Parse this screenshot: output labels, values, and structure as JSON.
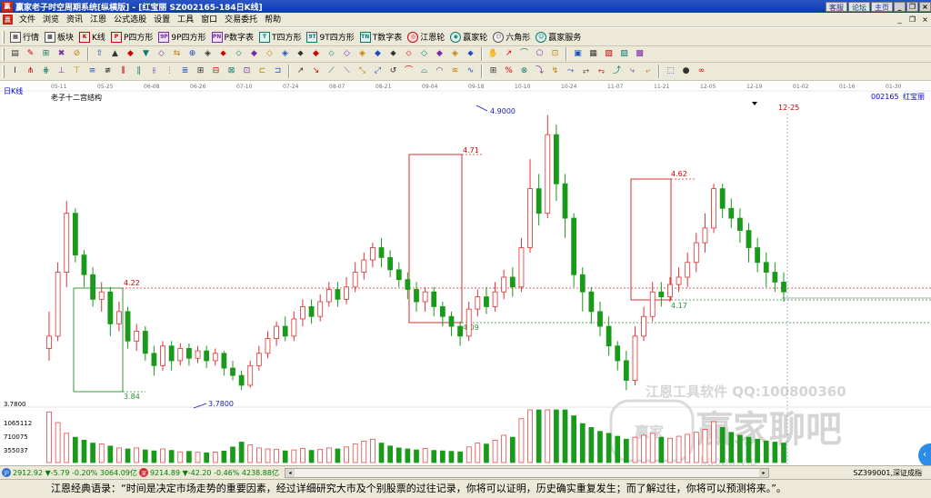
{
  "window": {
    "title": "赢家老子时空周期系统[纵横版] - [红宝丽  SZ002165-184日K线]",
    "buttons": [
      "客服",
      "论坛",
      "主页"
    ],
    "controls": [
      "_",
      "❐",
      "×"
    ]
  },
  "menu": {
    "items": [
      "文件",
      "浏览",
      "资讯",
      "江恩",
      "公式选股",
      "设置",
      "工具",
      "窗口",
      "交易委托",
      "帮助"
    ],
    "controls": [
      "_",
      "❐",
      "×"
    ]
  },
  "toolbar1": {
    "items": [
      {
        "label": "行情",
        "icon": "grid-icon",
        "glyph": "▦",
        "style": "ic-blk"
      },
      {
        "label": "板块",
        "icon": "block-icon",
        "glyph": "▩",
        "style": "ic-blk"
      },
      {
        "label": "K线",
        "icon": "kline-icon",
        "glyph": "K",
        "style": "ic-red"
      },
      {
        "label": "P四方形",
        "icon": "p-square-icon",
        "glyph": "P",
        "style": "ic-red"
      },
      {
        "label": "9P四方形",
        "icon": "9p-square-icon",
        "glyph": "9P",
        "style": "ic-pur"
      },
      {
        "label": "P数字表",
        "icon": "p-table-icon",
        "glyph": "PN",
        "style": "ic-pur"
      },
      {
        "label": "T四方形",
        "icon": "t-square-icon",
        "glyph": "T",
        "style": "ic-teal"
      },
      {
        "label": "9T四方形",
        "icon": "9t-square-icon",
        "glyph": "9T",
        "style": "ic-teal"
      },
      {
        "label": "T数字表",
        "icon": "t-table-icon",
        "glyph": "TN",
        "style": "ic-teal"
      },
      {
        "label": "江恩轮",
        "icon": "gann-wheel-icon",
        "glyph": "◎",
        "style": "ic-red ic-circ"
      },
      {
        "label": "赢家轮",
        "icon": "winner-wheel-icon",
        "glyph": "◉",
        "style": "ic-teal ic-circ"
      },
      {
        "label": "六角形",
        "icon": "hexagon-icon",
        "glyph": "⬡",
        "style": "ic-blk ic-circ"
      },
      {
        "label": "赢家服务",
        "icon": "service-icon",
        "glyph": "☺",
        "style": "ic-teal ic-circ"
      }
    ]
  },
  "toolbar2": {
    "icons": [
      "▤",
      "✎",
      "⊞",
      "✖",
      "⊘",
      "⇧",
      "▲",
      "◆",
      "▼",
      "◇",
      "⇆",
      "⊕",
      "◈",
      "⬥",
      "⬦",
      "◆",
      "◇",
      "◈",
      "⬥",
      "◆",
      "⬦",
      "◇",
      "◈",
      "◆",
      "⬥",
      "⬦",
      "◇",
      "◆",
      "◈",
      "⬥",
      "✋",
      "↗",
      "⌒",
      "⬠",
      "⊡",
      "▣",
      "▦",
      "▧",
      "▨",
      "▩"
    ]
  },
  "toolbar3": {
    "icons": [
      "I",
      "⋔",
      "⋕",
      "⊥",
      "⊤",
      "≡",
      "≢",
      "⫼",
      "∥",
      "⫲",
      "⋮",
      "≣",
      "⊞",
      "⊟",
      "⊠",
      "⊡",
      "⊏",
      "⊐",
      "↗",
      "↘",
      "⟋",
      "⟍",
      "⤡",
      "⤢",
      "↺",
      "⌒",
      "⌓",
      "◠",
      "≋",
      "∿",
      "⊞",
      "%",
      "⊗",
      "⤵",
      "↯",
      "⤳",
      "⥅",
      "⥆",
      "⤴",
      "⤷",
      "⤶",
      "⬚",
      "●",
      "∞"
    ]
  },
  "chart": {
    "period_label": "日K线",
    "study_label": "老子十二宫结构",
    "stock_code": "002165",
    "stock_name": "红宝丽",
    "dates": [
      "05-11",
      "05-25",
      "06-08",
      "06-26",
      "07-10",
      "07-24",
      "08-07",
      "08-21",
      "09-04",
      "09-18",
      "10-10",
      "10-24",
      "11-07",
      "11-21",
      "12-05",
      "12-19",
      "01-02",
      "01-16",
      "01-30"
    ],
    "marker_date": "12-25",
    "annotations": [
      "4.9000",
      "4.71",
      "4.62",
      "4.22",
      "4.17",
      "4.09",
      "3.84",
      "3.7800"
    ],
    "volume_axis": [
      "3.7800",
      "1065112",
      "710075",
      "355037"
    ],
    "watermark": {
      "line1": "江恩工具软件  QQ:100800360",
      "line2": "赢家聊吧",
      "logo": "赢家",
      "url": "liaoba.vip"
    },
    "candles": [
      [
        3.95,
        4.0,
        4.1,
        3.9
      ],
      [
        4.0,
        4.26,
        4.3,
        3.98
      ],
      [
        4.26,
        4.5,
        4.55,
        4.2
      ],
      [
        4.5,
        4.33,
        4.52,
        4.3
      ],
      [
        4.33,
        4.25,
        4.35,
        4.2
      ],
      [
        4.25,
        4.15,
        4.28,
        4.12
      ],
      [
        4.15,
        4.18,
        4.22,
        4.1
      ],
      [
        4.18,
        4.05,
        4.2,
        4.0
      ],
      [
        4.05,
        4.1,
        4.14,
        4.02
      ],
      [
        4.1,
        3.98,
        4.12,
        3.95
      ],
      [
        3.98,
        4.02,
        4.05,
        3.94
      ],
      [
        4.02,
        3.93,
        4.04,
        3.9
      ],
      [
        3.93,
        3.88,
        3.96,
        3.84
      ],
      [
        3.88,
        3.96,
        3.98,
        3.86
      ],
      [
        3.96,
        3.9,
        3.98,
        3.86
      ],
      [
        3.9,
        3.95,
        3.97,
        3.88
      ],
      [
        3.95,
        3.91,
        3.97,
        3.88
      ],
      [
        3.91,
        3.94,
        3.96,
        3.89
      ],
      [
        3.94,
        3.9,
        3.96,
        3.87
      ],
      [
        3.9,
        3.93,
        3.95,
        3.88
      ],
      [
        3.93,
        3.87,
        3.94,
        3.84
      ],
      [
        3.87,
        3.84,
        3.9,
        3.82
      ],
      [
        3.84,
        3.8,
        3.86,
        3.78
      ],
      [
        3.8,
        3.88,
        3.9,
        3.79
      ],
      [
        3.88,
        3.93,
        3.96,
        3.86
      ],
      [
        3.93,
        3.99,
        4.02,
        3.91
      ],
      [
        3.99,
        4.04,
        4.06,
        3.96
      ],
      [
        4.04,
        4.0,
        4.08,
        3.98
      ],
      [
        4.0,
        4.07,
        4.1,
        3.98
      ],
      [
        4.07,
        4.12,
        4.15,
        4.04
      ],
      [
        4.12,
        4.08,
        4.15,
        4.05
      ],
      [
        4.08,
        4.14,
        4.17,
        4.06
      ],
      [
        4.14,
        4.19,
        4.22,
        4.12
      ],
      [
        4.19,
        4.15,
        4.22,
        4.12
      ],
      [
        4.15,
        4.2,
        4.24,
        4.13
      ],
      [
        4.2,
        4.26,
        4.3,
        4.18
      ],
      [
        4.26,
        4.31,
        4.34,
        4.23
      ],
      [
        4.31,
        4.36,
        4.38,
        4.28
      ],
      [
        4.36,
        4.32,
        4.4,
        4.28
      ],
      [
        4.32,
        4.27,
        4.35,
        4.24
      ],
      [
        4.27,
        4.23,
        4.3,
        4.2
      ],
      [
        4.23,
        4.19,
        4.26,
        4.15
      ],
      [
        4.19,
        4.14,
        4.22,
        4.1
      ],
      [
        4.14,
        4.18,
        4.2,
        4.1
      ],
      [
        4.18,
        4.12,
        4.2,
        4.08
      ],
      [
        4.12,
        4.08,
        4.14,
        4.04
      ],
      [
        4.08,
        4.04,
        4.1,
        4.0
      ],
      [
        4.04,
        4.0,
        4.06,
        3.96
      ],
      [
        4.0,
        4.11,
        4.14,
        3.98
      ],
      [
        4.11,
        4.16,
        4.19,
        4.08
      ],
      [
        4.16,
        4.12,
        4.2,
        4.09
      ],
      [
        4.12,
        4.18,
        4.22,
        4.1
      ],
      [
        4.18,
        4.24,
        4.27,
        4.15
      ],
      [
        4.24,
        4.2,
        4.28,
        4.16
      ],
      [
        4.2,
        4.36,
        4.4,
        4.18
      ],
      [
        4.36,
        4.6,
        4.72,
        4.34
      ],
      [
        4.6,
        4.5,
        4.66,
        4.45
      ],
      [
        4.5,
        4.82,
        4.9,
        4.48
      ],
      [
        4.82,
        4.62,
        4.86,
        4.55
      ],
      [
        4.62,
        4.48,
        4.66,
        4.4
      ],
      [
        4.48,
        4.25,
        4.5,
        4.2
      ],
      [
        4.25,
        4.18,
        4.28,
        4.1
      ],
      [
        4.18,
        4.1,
        4.2,
        4.05
      ],
      [
        4.1,
        4.04,
        4.14,
        4.0
      ],
      [
        4.04,
        3.96,
        4.08,
        3.92
      ],
      [
        3.96,
        3.9,
        3.98,
        3.86
      ],
      [
        3.9,
        3.82,
        3.94,
        3.78
      ],
      [
        3.82,
        4.0,
        4.04,
        3.8
      ],
      [
        4.0,
        4.08,
        4.12,
        3.98
      ],
      [
        4.08,
        4.18,
        4.22,
        4.06
      ],
      [
        4.18,
        4.16,
        4.22,
        4.12
      ],
      [
        4.16,
        4.21,
        4.24,
        4.14
      ],
      [
        4.21,
        4.24,
        4.28,
        4.18
      ],
      [
        4.24,
        4.3,
        4.34,
        4.2
      ],
      [
        4.3,
        4.38,
        4.42,
        4.26
      ],
      [
        4.38,
        4.44,
        4.5,
        4.34
      ],
      [
        4.44,
        4.6,
        4.62,
        4.42
      ],
      [
        4.6,
        4.52,
        4.62,
        4.48
      ],
      [
        4.52,
        4.48,
        4.56,
        4.44
      ],
      [
        4.48,
        4.43,
        4.52,
        4.38
      ],
      [
        4.43,
        4.36,
        4.46,
        4.3
      ],
      [
        4.36,
        4.3,
        4.4,
        4.26
      ],
      [
        4.3,
        4.26,
        4.34,
        4.2
      ],
      [
        4.26,
        4.22,
        4.3,
        4.18
      ],
      [
        4.22,
        4.18,
        4.26,
        4.14
      ]
    ],
    "volumes": [
      520000,
      410000,
      300000,
      260000,
      230000,
      200000,
      190000,
      170000,
      150000,
      140000,
      150000,
      130000,
      120000,
      140000,
      125000,
      110000,
      115000,
      105000,
      100000,
      108000,
      118000,
      160000,
      210000,
      180000,
      150000,
      140000,
      135000,
      120000,
      130000,
      145000,
      125000,
      135000,
      150000,
      140000,
      160000,
      190000,
      220000,
      240000,
      200000,
      170000,
      150000,
      140000,
      130000,
      145000,
      125000,
      120000,
      115000,
      110000,
      160000,
      200000,
      190000,
      230000,
      280000,
      260000,
      450000,
      1080000,
      820000,
      1050000,
      760000,
      600000,
      480000,
      400000,
      360000,
      320000,
      300000,
      270000,
      240000,
      260000,
      280000,
      300000,
      260000,
      250000,
      270000,
      290000,
      310000,
      340000,
      420000,
      360000,
      310000,
      280000,
      260000,
      240000,
      220000,
      210000,
      200000
    ]
  },
  "statusbar": {
    "index1_icon": "沪",
    "index1": "2912.92 ▼-5.79 -0.20% 3064.09亿",
    "index2_icon": "深",
    "index2": "9214.89 ▼-42.20 -0.46% 4238.88亿",
    "right_label": "SZ399001,深证成指"
  },
  "quote": "江恩经典语录：“时间是决定市场走势的重要因素，经过详细研究大市及个别股票的过往记录，你将可以证明，历史确实重复发生；而了解过往，你将可以预测将来。”。"
}
